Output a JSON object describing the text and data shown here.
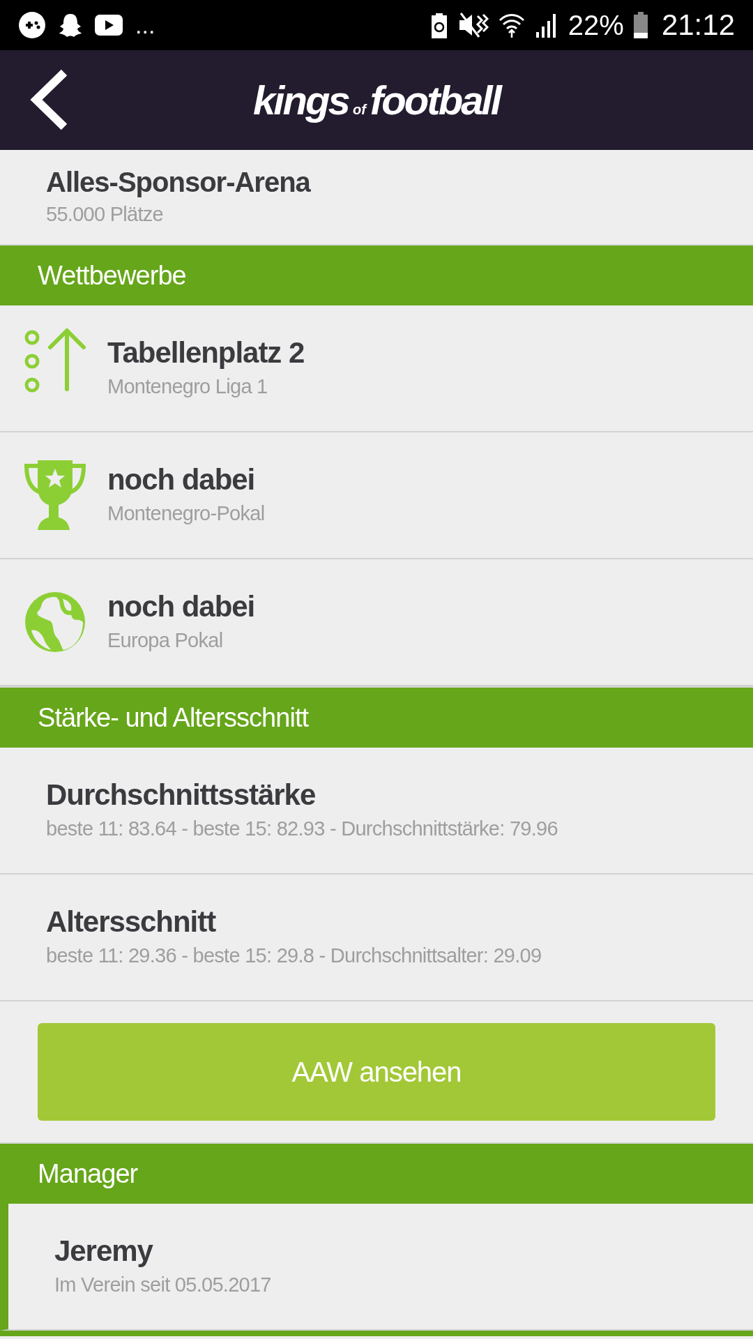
{
  "status_bar": {
    "overflow": "...",
    "battery": "22%",
    "time": "21:12"
  },
  "header": {
    "logo": [
      "kings",
      "of",
      "football"
    ]
  },
  "stadium": {
    "name": "Alles-Sponsor-Arena",
    "capacity": "55.000 Plätze"
  },
  "sections": [
    {
      "title": "Wettbewerbe",
      "items": [
        {
          "kind": "rank",
          "title": "Tabellenplatz 2",
          "subtitle": "Montenegro Liga 1"
        },
        {
          "kind": "cup",
          "title": "noch dabei",
          "subtitle": "Montenegro-Pokal"
        },
        {
          "kind": "globe",
          "title": "noch dabei",
          "subtitle": "Europa Pokal"
        }
      ]
    },
    {
      "title": "Stärke- und Altersschnitt",
      "items": [
        {
          "title": "Durchschnittsstärke",
          "subtitle": "beste 11: 83.64 - beste 15: 82.93 - Durchschnittstärke: 79.96"
        },
        {
          "title": "Altersschnitt",
          "subtitle": "beste 11: 29.36 - beste 15: 29.8 - Durchschnittsalter: 29.09"
        }
      ],
      "button": "AAW ansehen"
    },
    {
      "title": "Manager",
      "kind": "manager",
      "items": [
        {
          "title": "Jeremy",
          "subtitle": "Im Verein seit 05.05.2017"
        }
      ]
    }
  ]
}
